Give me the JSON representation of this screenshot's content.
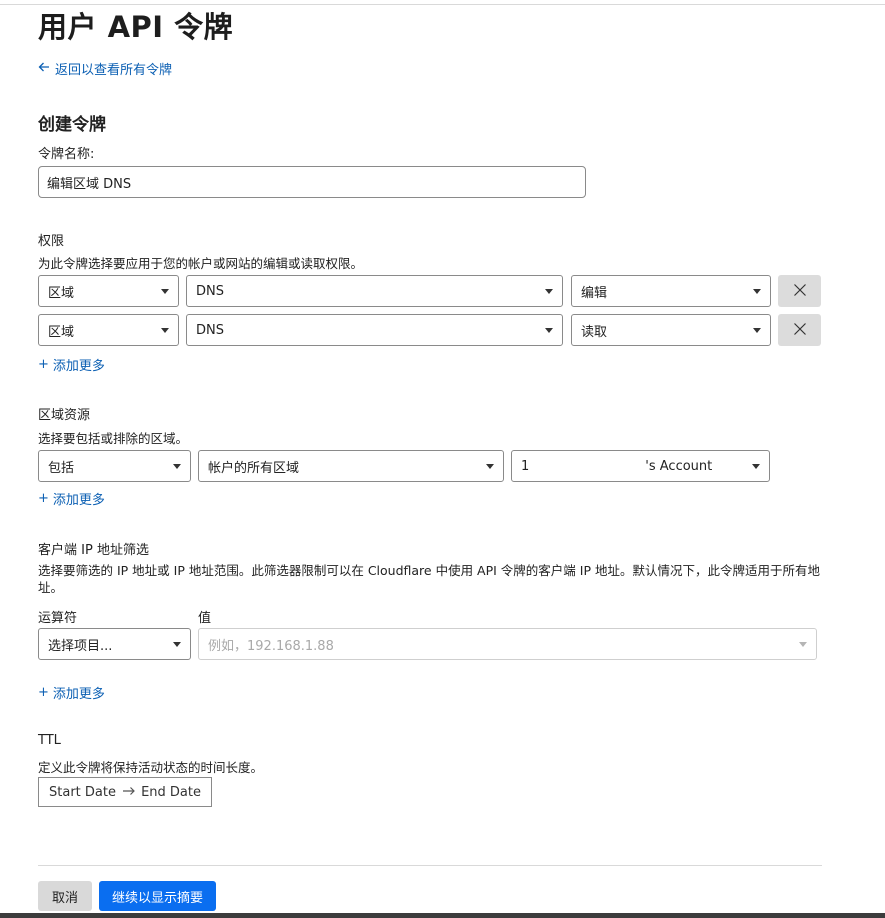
{
  "page": {
    "title": "用户 API 令牌",
    "back_link": "返回以查看所有令牌"
  },
  "create": {
    "heading": "创建令牌",
    "name_label": "令牌名称:",
    "name_value": "编辑区域 DNS"
  },
  "permissions": {
    "heading": "权限",
    "description": "为此令牌选择要应用于您的帐户或网站的编辑或读取权限。",
    "rows": [
      {
        "scope": "区域",
        "resource": "DNS",
        "level": "编辑"
      },
      {
        "scope": "区域",
        "resource": "DNS",
        "level": "读取"
      }
    ],
    "add_more": "添加更多"
  },
  "zone_resources": {
    "heading": "区域资源",
    "description": "选择要包括或排除的区域。",
    "include": "包括",
    "zone_scope": "帐户的所有区域",
    "account_prefix": "1",
    "account_suffix": "'s Account",
    "add_more": "添加更多"
  },
  "ip_filter": {
    "heading": "客户端 IP 地址筛选",
    "description": "选择要筛选的 IP 地址或 IP 地址范围。此筛选器限制可以在 Cloudflare 中使用 API 令牌的客户端 IP 地址。默认情况下，此令牌适用于所有地址。",
    "operator_label": "运算符",
    "value_label": "值",
    "operator_placeholder": "选择项目...",
    "value_placeholder": "例如，192.168.1.88",
    "add_more": "添加更多"
  },
  "ttl": {
    "heading": "TTL",
    "description": "定义此令牌将保持活动状态的时间长度。",
    "start_date": "Start Date",
    "end_date": "End Date"
  },
  "actions": {
    "cancel": "取消",
    "continue": "继续以显示摘要"
  },
  "icons": {
    "back": "arrow-left-icon",
    "remove": "close-icon",
    "add": "plus-icon",
    "dropdown": "caret-down-icon",
    "range": "arrow-right-icon"
  },
  "colors": {
    "link": "#0b5fb3",
    "primary_button": "#0a6ef0",
    "secondary_button": "#d9d9d9"
  }
}
